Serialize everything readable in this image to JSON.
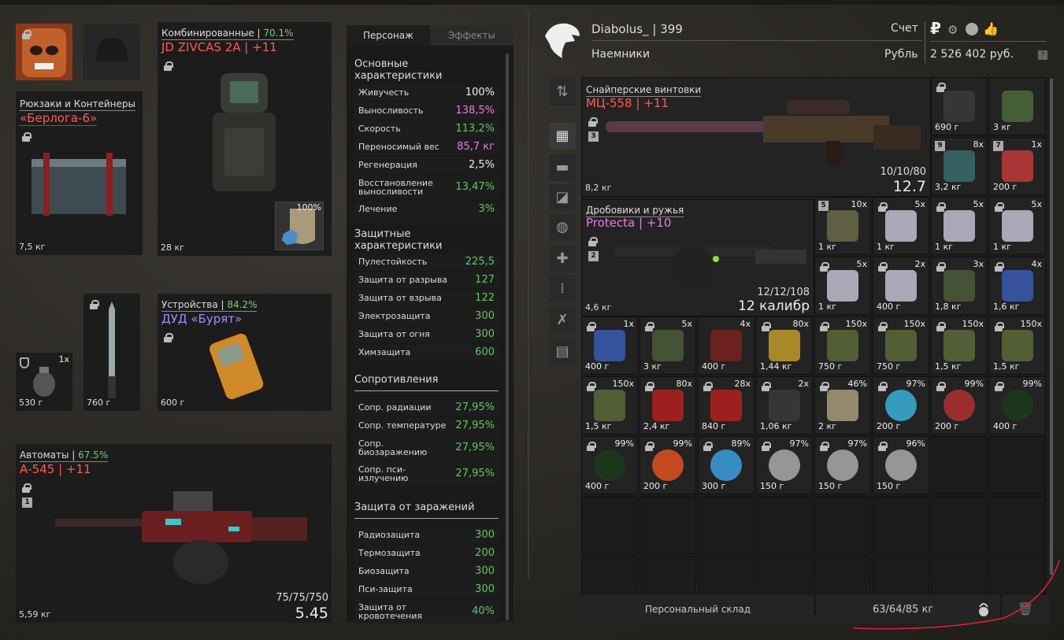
{
  "equip": {
    "helmet_lock": "",
    "backpack": {
      "category": "Рюкзаки и Контейнеры",
      "name": "«Берлога-6»",
      "weight": "7,5 кг"
    },
    "armor": {
      "category": "Комбинированные",
      "sep": " | ",
      "pct": "70.1%",
      "name": "JD ZIVCAS 2A  | +11",
      "weight": "28 кг",
      "plate_pct": "100%"
    },
    "grenade": {
      "count": "1x",
      "weight": "530 г"
    },
    "knife": {
      "weight": "760 г"
    },
    "device": {
      "category": "Устройства",
      "sep": " | ",
      "pct": "84.2%",
      "name": "ДУД «Бурят»",
      "weight": "600 г"
    },
    "rifle": {
      "category": "Автоматы",
      "sep": " | ",
      "pct": "67.5%",
      "name": "А-545  | +11",
      "weight": "5,59 кг",
      "ammo": "75/75/750",
      "caliber": "5.45",
      "slot_num": "1"
    }
  },
  "stats": {
    "tab_char": "Персонаж",
    "tab_effects": "Эффекты",
    "sec1": "Основные характеристики",
    "main": [
      {
        "k": "Живучесть",
        "v": "100%",
        "c": "w"
      },
      {
        "k": "Выносливость",
        "v": "138,5%",
        "c": "p"
      },
      {
        "k": "Скорость",
        "v": "113,2%",
        "c": "g"
      },
      {
        "k": "Переносимый вес",
        "v": "85,7 кг",
        "c": "p"
      },
      {
        "k": "Регенерация",
        "v": "2,5%",
        "c": "w"
      },
      {
        "k": "Восстановление выносливости",
        "v": "13,47%",
        "c": "g"
      },
      {
        "k": "Лечение",
        "v": "3%",
        "c": "g"
      }
    ],
    "sec2": "Защитные характеристики",
    "prot": [
      {
        "k": "Пулестойкость",
        "v": "225,5"
      },
      {
        "k": "Защита от разрыва",
        "v": "127"
      },
      {
        "k": "Защита от взрыва",
        "v": "122"
      },
      {
        "k": "Электрозащита",
        "v": "300"
      },
      {
        "k": "Защита от огня",
        "v": "300"
      },
      {
        "k": "Химзащита",
        "v": "600"
      }
    ],
    "sec3": "Сопротивления",
    "res": [
      {
        "k": "Сопр. радиации",
        "v": "27,95%"
      },
      {
        "k": "Сопр. температуре",
        "v": "27,95%"
      },
      {
        "k": "Сопр. биозаражению",
        "v": "27,95%"
      },
      {
        "k": "Сопр. пси-излучению",
        "v": "27,95%"
      }
    ],
    "sec4": "Защита от заражений",
    "inf": [
      {
        "k": "Радиозащита",
        "v": "300"
      },
      {
        "k": "Термозащита",
        "v": "200"
      },
      {
        "k": "Биозащита",
        "v": "300"
      },
      {
        "k": "Пси-защита",
        "v": "300"
      },
      {
        "k": "Защита от кровотечения",
        "v": "40%"
      }
    ]
  },
  "header": {
    "player": "Diabolus_ | 399",
    "faction": "Наемники",
    "account_label": "Счет",
    "currency_label": "Рубль",
    "money": "2 526 402 руб.",
    "help": "?"
  },
  "inventory": {
    "sniper": {
      "category": "Снайперские винтовки",
      "name": "МЦ-558 | +11",
      "slot": "3",
      "ammo": "10/10/80",
      "caliber": "12.7",
      "weight": "8,2 кг"
    },
    "shotgun": {
      "category": "Дробовики и ружья",
      "name": "Protecta | +10",
      "slot": "2",
      "ammo": "12/12/108",
      "caliber": "12 калибр",
      "weight": "4,6 кг"
    },
    "cells": [
      {
        "q": "",
        "w": "690 г"
      },
      {
        "q": "",
        "w": "3 кг"
      },
      {
        "q": "8x",
        "w": "3,2 кг",
        "badge": "9"
      },
      {
        "q": "1x",
        "w": "200 г",
        "badge": "7"
      },
      {
        "q": "10x",
        "w": "1 кг",
        "badge": "5"
      },
      {
        "q": "5x",
        "w": "1 кг"
      },
      {
        "q": "5x",
        "w": "1 кг"
      },
      {
        "q": "5x",
        "w": "1 кг"
      },
      {
        "q": "5x",
        "w": "1 кг"
      },
      {
        "q": "2x",
        "w": "400 г"
      },
      {
        "q": "3x",
        "w": "1,8 кг"
      },
      {
        "q": "4x",
        "w": "1,6 кг"
      },
      {
        "q": "1x",
        "w": "400 г"
      },
      {
        "q": "5x",
        "w": "3 кг"
      },
      {
        "q": "4x",
        "w": "400 г"
      },
      {
        "q": "80x",
        "w": "1,44 кг"
      },
      {
        "q": "150x",
        "w": "750 г"
      },
      {
        "q": "150x",
        "w": "750 г"
      },
      {
        "q": "150x",
        "w": "1,5 кг"
      },
      {
        "q": "150x",
        "w": "1,5 кг"
      },
      {
        "q": "150x",
        "w": "1,5 кг"
      },
      {
        "q": "80x",
        "w": "2,4 кг"
      },
      {
        "q": "28x",
        "w": "840 г"
      },
      {
        "q": "2x",
        "w": "1,06 кг"
      },
      {
        "q": "46%",
        "w": "2 кг"
      },
      {
        "q": "97%",
        "w": "200 г"
      },
      {
        "q": "99%",
        "w": "200 г"
      },
      {
        "q": "99%",
        "w": "400 г"
      },
      {
        "q": "99%",
        "w": "400 г"
      },
      {
        "q": "99%",
        "w": "200 г"
      },
      {
        "q": "89%",
        "w": "300 г"
      },
      {
        "q": "97%",
        "w": "150 г"
      },
      {
        "q": "97%",
        "w": "150 г"
      },
      {
        "q": "96%",
        "w": "150 г"
      }
    ]
  },
  "footer": {
    "stash": "Персональный склад",
    "weight": "63/64/85 кг"
  },
  "colors": {
    "accent_red": "#ff5a5a",
    "green": "#5ec85e",
    "purple": "#e57ee5",
    "annotation": "#e0202a"
  }
}
